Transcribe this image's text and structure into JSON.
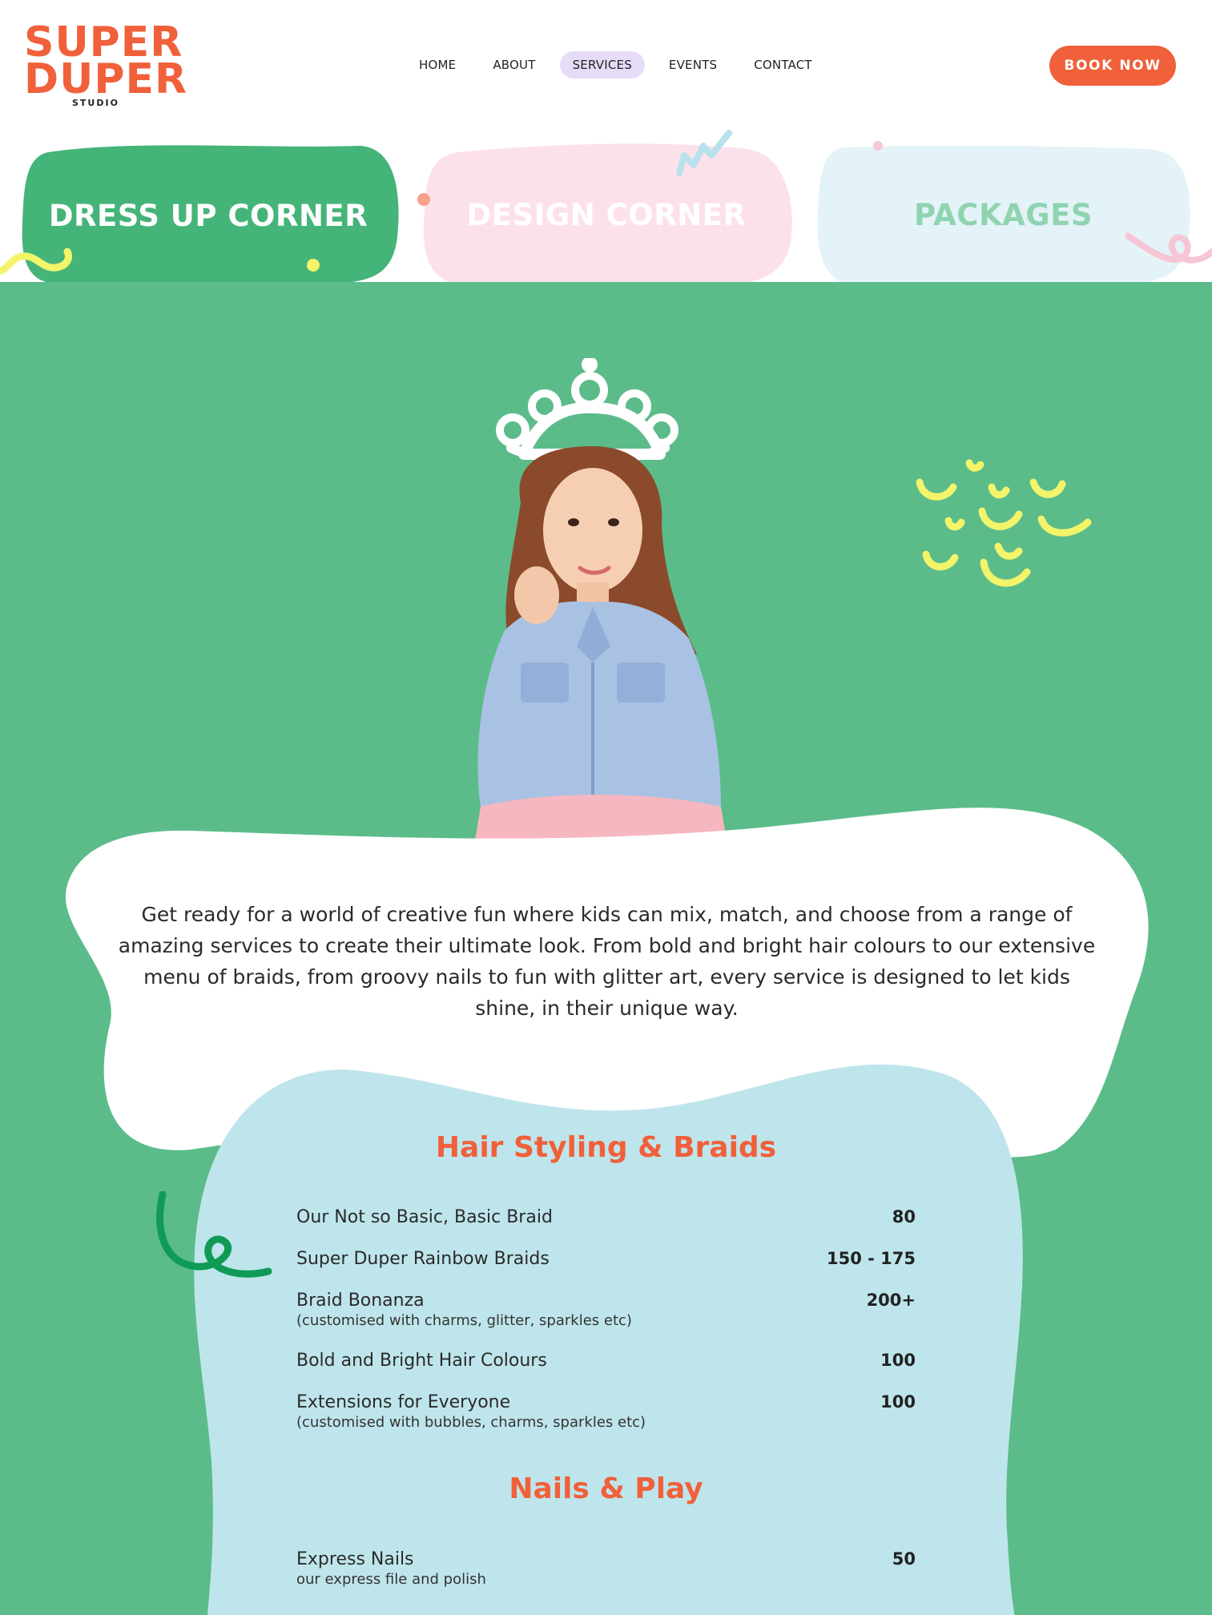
{
  "brand": {
    "logo_line1": "SUPER",
    "logo_line2": "DUPER",
    "logo_sub": "STUDIO",
    "logo_color": "#f0603a"
  },
  "nav": {
    "items": [
      {
        "label": "HOME",
        "active": false
      },
      {
        "label": "ABOUT",
        "active": false
      },
      {
        "label": "SERVICES",
        "active": true
      },
      {
        "label": "EVENTS",
        "active": false
      },
      {
        "label": "CONTACT",
        "active": false
      }
    ],
    "active_color": "#e6dcf8"
  },
  "cta": {
    "label": "BOOK NOW",
    "color": "#f0603a"
  },
  "tabs": [
    {
      "label": "DRESS UP CORNER",
      "bg": "#45b479",
      "text_color": "#ffffff"
    },
    {
      "label": "DESIGN CORNER",
      "bg": "#fde1ea",
      "text_color": "#ffffff"
    },
    {
      "label": "PACKAGES",
      "bg": "#e4f3f8",
      "text_color": "#8fd4b0"
    }
  ],
  "hero": {
    "bg": "#5bbc8a",
    "image_alt": "girl with paper crown prop",
    "intro": "Get ready for a world of creative fun where kids can mix, match, and choose from a range of amazing services to create their ultimate look. From bold and bright hair colours to our extensive menu of braids, from groovy nails to fun with glitter art, every service is designed to let kids shine, in their unique way."
  },
  "menu": {
    "bg": "#bfe5ec",
    "sections": [
      {
        "title": "Hair Styling & Braids",
        "items": [
          {
            "name": "Our Not so Basic, Basic Braid",
            "note": "",
            "price": "80"
          },
          {
            "name": "Super Duper Rainbow Braids",
            "note": "",
            "price": "150 - 175"
          },
          {
            "name": "Braid Bonanza",
            "note": "(customised with charms, glitter, sparkles etc)",
            "price": "200+"
          },
          {
            "name": "Bold and Bright Hair Colours",
            "note": "",
            "price": "100"
          },
          {
            "name": "Extensions for Everyone",
            "note": "(customised with bubbles, charms, sparkles etc)",
            "price": "100"
          }
        ]
      },
      {
        "title": "Nails & Play",
        "items": [
          {
            "name": "Express Nails",
            "note": "our express file and polish",
            "price": "50"
          }
        ]
      }
    ]
  },
  "colors": {
    "accent": "#f0603a",
    "green": "#5bbc8a",
    "yellow": "#f3f46a",
    "dark_green_squiggle": "#0f9b55"
  }
}
